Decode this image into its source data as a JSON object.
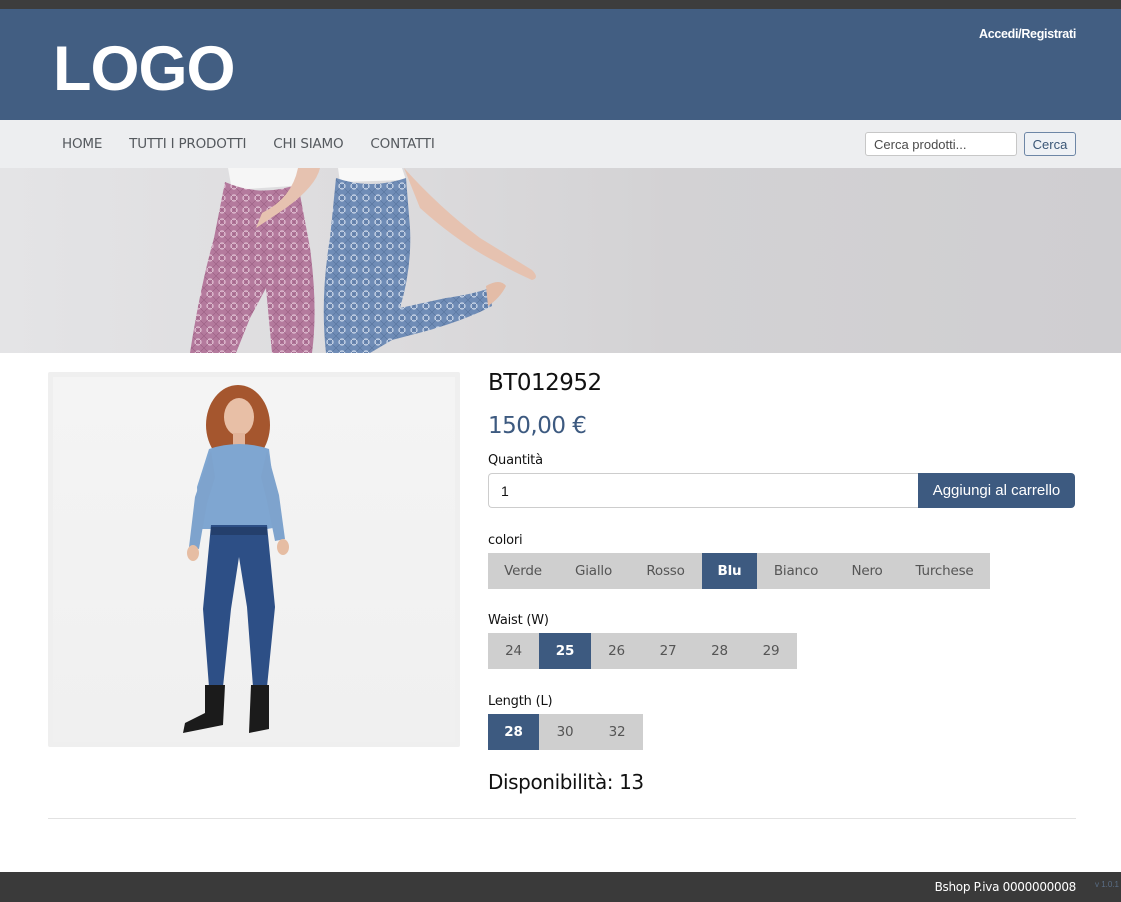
{
  "header": {
    "logo_text": "LOGO",
    "login_label": "Accedi/Registrati"
  },
  "nav": {
    "items": [
      {
        "label": "HOME"
      },
      {
        "label": "TUTTI I PRODOTTI"
      },
      {
        "label": "CHI SIAMO"
      },
      {
        "label": "CONTATTI"
      }
    ],
    "search_placeholder": "Cerca prodotti...",
    "search_button": "Cerca"
  },
  "product": {
    "sku": "BT012952",
    "price": "150,00 €",
    "quantity_label": "Quantità",
    "quantity_value": "1",
    "add_to_cart": "Aggiungi al carrello",
    "colors_label": "colori",
    "colors": [
      "Verde",
      "Giallo",
      "Rosso",
      "Blu",
      "Bianco",
      "Nero",
      "Turchese"
    ],
    "selected_color": "Blu",
    "waist_label": "Waist (W)",
    "waist_sizes": [
      "24",
      "25",
      "26",
      "27",
      "28",
      "29"
    ],
    "selected_waist": "25",
    "length_label": "Length (L)",
    "length_sizes": [
      "28",
      "30",
      "32"
    ],
    "selected_length": "28",
    "availability": "Disponibilità: 13"
  },
  "footer": {
    "text": "Bshop P.iva 0000000008",
    "version": "v 1.0.1"
  },
  "colors": {
    "brand": "#425e82",
    "accent": "#3d5a80",
    "option_bg": "#cfcfcf"
  }
}
